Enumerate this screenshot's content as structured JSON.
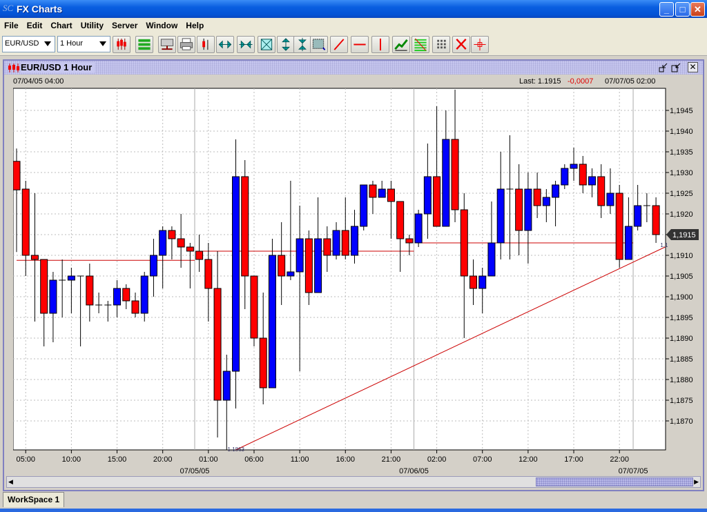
{
  "window": {
    "title": "FX Charts",
    "minimize": "_",
    "maximize": "□",
    "close": "✕"
  },
  "menu": [
    "File",
    "Edit",
    "Chart",
    "Utility",
    "Server",
    "Window",
    "Help"
  ],
  "toolbar": {
    "symbol": "EUR/USD",
    "timeframe": "1 Hour",
    "buttons": [
      "candlestick-chart",
      "indicators",
      "server",
      "print",
      "bar-chart",
      "expand-horizontal",
      "compress-horizontal",
      "fit-chart",
      "expand-vertical",
      "compress-vertical",
      "zoom-select",
      "trend-line",
      "horizontal-line",
      "vertical-line",
      "line-chart",
      "fibonacci",
      "grid",
      "delete",
      "crosshair"
    ]
  },
  "chart_window": {
    "title": "EUR/USD 1 Hour",
    "start_time": "07/04/05 04:00",
    "last_label": "Last: 1.1915",
    "change": "-0,0007",
    "end_time": "07/07/05 02:00",
    "current_price": "1,1915",
    "trendline_label": "1.1863",
    "trendline_end_label": "1.1"
  },
  "colors": {
    "up": "#0000ff",
    "down": "#ff0000",
    "line": "#cc0000",
    "change": "#e00000"
  },
  "workspace_tab": "WorkSpace 1",
  "chart_data": {
    "type": "candlestick",
    "title": "EUR/USD 1 Hour",
    "ylim": [
      1.18625,
      1.1952
    ],
    "yticks": [
      "1,1870",
      "1,1875",
      "1,1880",
      "1,1885",
      "1,1890",
      "1,1895",
      "1,1900",
      "1,1905",
      "1,1910",
      "1,1915",
      "1,1920",
      "1,1925",
      "1,1930",
      "1,1935",
      "1,1940",
      "1,1945"
    ],
    "ytick_values": [
      1.187,
      1.1875,
      1.188,
      1.1885,
      1.189,
      1.1895,
      1.19,
      1.1905,
      1.191,
      1.1915,
      1.192,
      1.1925,
      1.193,
      1.1935,
      1.194,
      1.1945
    ],
    "xticks": [
      {
        "i": 1,
        "label": "05:00"
      },
      {
        "i": 6,
        "label": "10:00"
      },
      {
        "i": 11,
        "label": "15:00"
      },
      {
        "i": 16,
        "label": "20:00"
      },
      {
        "i": 21,
        "label": "01:00"
      },
      {
        "i": 26,
        "label": "06:00"
      },
      {
        "i": 31,
        "label": "11:00"
      },
      {
        "i": 36,
        "label": "16:00"
      },
      {
        "i": 41,
        "label": "21:00"
      },
      {
        "i": 46,
        "label": "02:00"
      },
      {
        "i": 51,
        "label": "07:00"
      },
      {
        "i": 56,
        "label": "12:00"
      },
      {
        "i": 61,
        "label": "17:00"
      },
      {
        "i": 66,
        "label": "22:00"
      }
    ],
    "date_ticks": [
      {
        "i": 20,
        "label": "07/05/05"
      },
      {
        "i": 44,
        "label": "07/06/05"
      },
      {
        "i": 68,
        "label": "07/07/05"
      }
    ],
    "ohlc": [
      [
        1.19327,
        1.19358,
        1.19108,
        1.19258
      ],
      [
        1.1926,
        1.1928,
        1.1905,
        1.191
      ],
      [
        1.191,
        1.1925,
        1.1894,
        1.1909
      ],
      [
        1.1909,
        1.1909,
        1.1888,
        1.1896
      ],
      [
        1.1896,
        1.1906,
        1.1889,
        1.1904
      ],
      [
        1.1904,
        1.1909,
        1.1895,
        1.1904
      ],
      [
        1.1904,
        1.1907,
        1.1896,
        1.1905
      ],
      [
        1.1905,
        1.1905,
        1.1888,
        1.1905
      ],
      [
        1.1905,
        1.1908,
        1.1894,
        1.1898
      ],
      [
        1.1898,
        1.1901,
        1.1896,
        1.1898
      ],
      [
        1.1898,
        1.1899,
        1.1894,
        1.1898
      ],
      [
        1.1898,
        1.1904,
        1.1895,
        1.1902
      ],
      [
        1.1902,
        1.1903,
        1.1897,
        1.1899
      ],
      [
        1.1899,
        1.1901,
        1.1895,
        1.1896
      ],
      [
        1.1896,
        1.1906,
        1.1894,
        1.1905
      ],
      [
        1.1905,
        1.1914,
        1.19,
        1.191
      ],
      [
        1.191,
        1.1917,
        1.1902,
        1.1916
      ],
      [
        1.1916,
        1.1917,
        1.1909,
        1.1914
      ],
      [
        1.1914,
        1.192,
        1.1907,
        1.1912
      ],
      [
        1.1912,
        1.1913,
        1.1902,
        1.1911
      ],
      [
        1.1911,
        1.1915,
        1.1906,
        1.1909
      ],
      [
        1.1909,
        1.1913,
        1.1894,
        1.1902
      ],
      [
        1.1902,
        1.1911,
        1.1866,
        1.1875
      ],
      [
        1.1875,
        1.1886,
        1.1863,
        1.1882
      ],
      [
        1.1882,
        1.1938,
        1.1873,
        1.1929
      ],
      [
        1.1929,
        1.1933,
        1.1897,
        1.1905
      ],
      [
        1.1905,
        1.1905,
        1.1888,
        1.189
      ],
      [
        1.189,
        1.1901,
        1.1874,
        1.1878
      ],
      [
        1.1878,
        1.1914,
        1.1878,
        1.191
      ],
      [
        1.191,
        1.1918,
        1.1898,
        1.1905
      ],
      [
        1.1905,
        1.1928,
        1.1904,
        1.1906
      ],
      [
        1.1906,
        1.1922,
        1.1882,
        1.1914
      ],
      [
        1.1914,
        1.1916,
        1.1898,
        1.1901
      ],
      [
        1.1901,
        1.1924,
        1.1901,
        1.1914
      ],
      [
        1.1914,
        1.1917,
        1.1906,
        1.191
      ],
      [
        1.191,
        1.1918,
        1.1909,
        1.1916
      ],
      [
        1.1916,
        1.1924,
        1.1909,
        1.191
      ],
      [
        1.191,
        1.1921,
        1.1908,
        1.1917
      ],
      [
        1.1917,
        1.1927,
        1.1916,
        1.1927
      ],
      [
        1.1927,
        1.1928,
        1.192,
        1.1924
      ],
      [
        1.1924,
        1.1928,
        1.1924,
        1.1926
      ],
      [
        1.1926,
        1.1928,
        1.1914,
        1.1923
      ],
      [
        1.1923,
        1.1923,
        1.1906,
        1.1914
      ],
      [
        1.1914,
        1.1915,
        1.191,
        1.1913
      ],
      [
        1.1913,
        1.1921,
        1.1912,
        1.192
      ],
      [
        1.192,
        1.1937,
        1.1914,
        1.1929
      ],
      [
        1.1929,
        1.1946,
        1.1917,
        1.1917
      ],
      [
        1.1917,
        1.1945,
        1.1917,
        1.1938
      ],
      [
        1.1938,
        1.195,
        1.1918,
        1.1921
      ],
      [
        1.1921,
        1.1925,
        1.189,
        1.1905
      ],
      [
        1.1905,
        1.1909,
        1.1898,
        1.1902
      ],
      [
        1.1902,
        1.1907,
        1.1896,
        1.1905
      ],
      [
        1.1905,
        1.1923,
        1.1905,
        1.1913
      ],
      [
        1.1913,
        1.1935,
        1.1909,
        1.1926
      ],
      [
        1.1926,
        1.1939,
        1.1909,
        1.1926
      ],
      [
        1.1926,
        1.1932,
        1.191,
        1.1916
      ],
      [
        1.1916,
        1.193,
        1.1908,
        1.1926
      ],
      [
        1.1926,
        1.193,
        1.1919,
        1.1922
      ],
      [
        1.1922,
        1.1926,
        1.1918,
        1.1924
      ],
      [
        1.1924,
        1.1928,
        1.1917,
        1.1927
      ],
      [
        1.1927,
        1.1932,
        1.1926,
        1.1931
      ],
      [
        1.1931,
        1.1936,
        1.1928,
        1.1932
      ],
      [
        1.1932,
        1.1934,
        1.1925,
        1.1927
      ],
      [
        1.1927,
        1.1931,
        1.1924,
        1.1929
      ],
      [
        1.1929,
        1.1932,
        1.1919,
        1.1922
      ],
      [
        1.1922,
        1.1931,
        1.192,
        1.1925
      ],
      [
        1.1925,
        1.1927,
        1.1907,
        1.1909
      ],
      [
        1.1909,
        1.1924,
        1.1909,
        1.1917
      ],
      [
        1.1917,
        1.1927,
        1.1916,
        1.1922
      ],
      [
        1.1922,
        1.1925,
        1.1918,
        1.1922
      ],
      [
        1.1922,
        1.1924,
        1.1913,
        1.1915
      ]
    ],
    "prev_close_lines": [
      {
        "from": 0,
        "to": 20,
        "price": 1.19088
      },
      {
        "from": 20,
        "to": 44,
        "price": 1.1911
      },
      {
        "from": 44,
        "to": 68,
        "price": 1.1913
      }
    ],
    "trendline": {
      "from_i": 24,
      "from_price": 1.1863,
      "to_i": 71,
      "to_price": 1.1912
    }
  }
}
